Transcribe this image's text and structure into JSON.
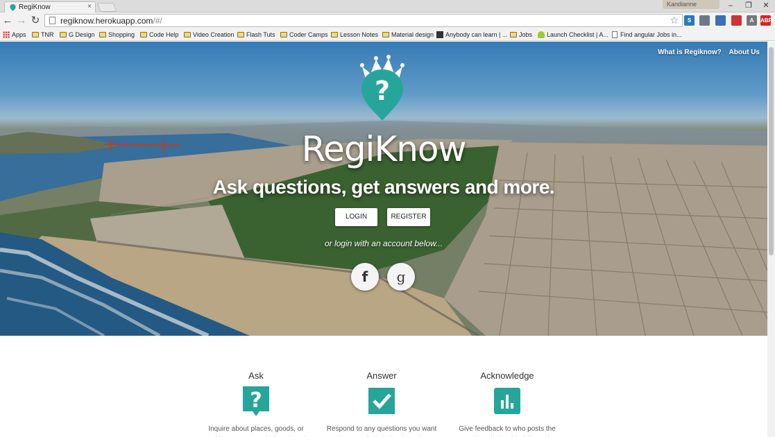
{
  "browser": {
    "tab_title": "RegiKnow",
    "tab_close": "×",
    "user_name": "Kandianne",
    "window_controls": [
      "–",
      "❐",
      "✕"
    ],
    "url_host": "regiknow.herokuapp.com",
    "url_path": "/#/",
    "nav": {
      "back": "←",
      "forward": "→",
      "reload": "↻"
    },
    "star_icon": "☆",
    "extensions": [
      {
        "label": "S",
        "color": "#2a7ab8"
      },
      {
        "label": "",
        "color": "#6d7a86"
      },
      {
        "label": "",
        "color": "#3b6fb6"
      },
      {
        "label": "",
        "color": "#c33"
      },
      {
        "label": "A",
        "color": "#777"
      },
      {
        "label": "ABP",
        "color": "#d22"
      },
      {
        "label": "≡",
        "color": "#3a9d3a"
      }
    ]
  },
  "bookmarks": [
    {
      "label": "Apps",
      "icon": "apps-icon"
    },
    {
      "label": "TNR",
      "icon": "folder-icon"
    },
    {
      "label": "G Design",
      "icon": "folder-icon"
    },
    {
      "label": "Shopping",
      "icon": "folder-icon"
    },
    {
      "label": "Code Help",
      "icon": "folder-icon"
    },
    {
      "label": "Video Creation",
      "icon": "folder-icon"
    },
    {
      "label": "Flash Tuts",
      "icon": "folder-icon"
    },
    {
      "label": "Coder Camps",
      "icon": "folder-icon"
    },
    {
      "label": "Lesson Notes",
      "icon": "folder-icon"
    },
    {
      "label": "Material design",
      "icon": "folder-icon"
    },
    {
      "label": "Anybody can learn | ...",
      "icon": "grid-icon"
    },
    {
      "label": "Jobs",
      "icon": "folder-icon"
    },
    {
      "label": "Launch Checklist | A...",
      "icon": "droid-icon"
    },
    {
      "label": "Find angular Jobs in...",
      "icon": "doc-icon"
    }
  ],
  "hero": {
    "nav": [
      "What is Regiknow?",
      "About Us"
    ],
    "brand": "RegiKnow",
    "tagline": "Ask questions, get answers and more.",
    "login_label": "LOGIN",
    "register_label": "REGISTER",
    "alt_login_text": "or login with an account below...",
    "facebook_glyph": "f",
    "google_glyph": "g"
  },
  "colors": {
    "accent": "#26a69a",
    "crown": "#ffffff"
  },
  "features": [
    {
      "title": "Ask",
      "icon": "question-bubble-icon",
      "text": "Inquire about places, goods, or anything you're wondering about in a"
    },
    {
      "title": "Answer",
      "icon": "checkmark-icon",
      "text": "Respond to any questions you want using your knowledge based on"
    },
    {
      "title": "Acknowledge",
      "icon": "bar-chart-icon",
      "text": "Give feedback to who posts the most knowledgeable information"
    }
  ]
}
